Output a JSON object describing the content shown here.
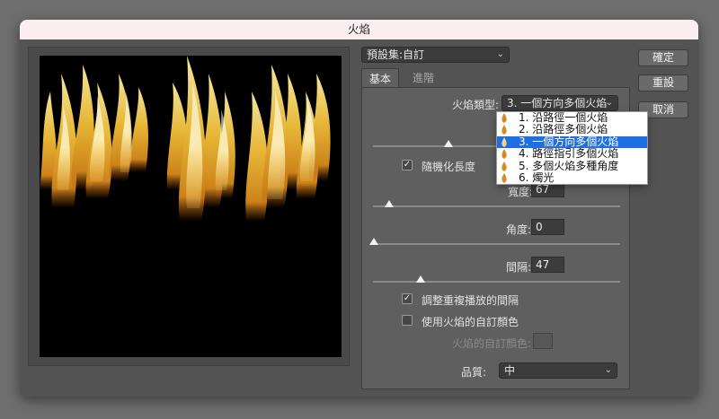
{
  "dialog": {
    "title": "火焰"
  },
  "preset": {
    "label": "預設集:",
    "value": "自訂"
  },
  "tabs": [
    {
      "label": "基本"
    },
    {
      "label": "進階"
    }
  ],
  "flame_type": {
    "label": "火焰類型:",
    "value": "3. 一個方向多個火焰",
    "options": [
      "1. 沿路徑一個火焰",
      "2. 沿路徑多個火焰",
      "3. 一個方向多個火焰",
      "4. 路徑指引多個火焰",
      "5. 多個火焰多種角度",
      "6. 燭光"
    ],
    "selected_index": 2
  },
  "randomize_length": {
    "label": "隨機化長度",
    "checked": true
  },
  "width": {
    "label": "寬度:",
    "value": "67"
  },
  "angle": {
    "label": "角度:",
    "value": "0"
  },
  "interval": {
    "label": "間隔:",
    "value": "47"
  },
  "adjust_interval": {
    "label": "調整重複播放的間隔",
    "checked": true
  },
  "custom_color": {
    "label": "使用火焰的自訂顏色",
    "checked": false
  },
  "custom_color_field": {
    "label": "火焰的自訂顏色:"
  },
  "quality": {
    "label": "品質:",
    "value": "中"
  },
  "buttons": {
    "ok": "確定",
    "reset": "重設",
    "cancel": "取消"
  },
  "icons": {
    "check": "checkmark-icon",
    "chevron": "chevron-down-icon"
  },
  "colors": {
    "dialog_bg": "#535353",
    "panel_bg": "#5f5f5f",
    "titlebar_bg": "#fbeef0",
    "selection": "#1f6fe4",
    "flame_core": "#fff3a6",
    "flame_mid": "#f5c23a",
    "flame_edge": "#b55a10"
  }
}
